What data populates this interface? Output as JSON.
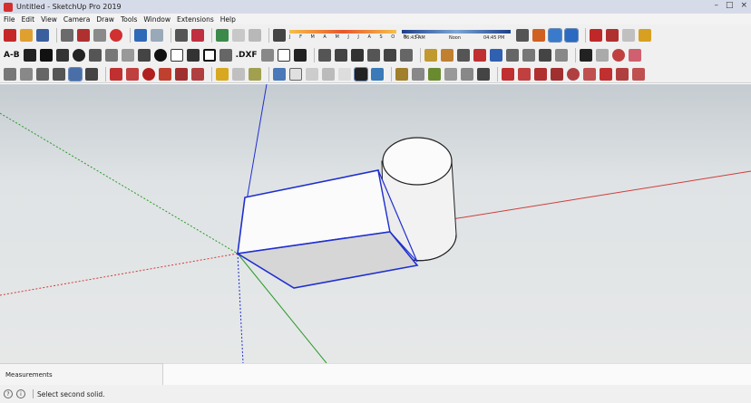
{
  "window": {
    "title": "Untitled - SketchUp Pro 2019"
  },
  "menu": [
    "File",
    "Edit",
    "View",
    "Camera",
    "Draw",
    "Tools",
    "Window",
    "Extensions",
    "Help"
  ],
  "shadow": {
    "months": "J F M A M J J A S O N D",
    "time_start": "06:43 AM",
    "time_mid": "Noon",
    "time_end": "04:45 PM"
  },
  "toolbar_labels": {
    "dimension": "A-B",
    "dxf": ".DXF"
  },
  "measurements": {
    "label": "Measurements"
  },
  "status": {
    "message": "Select second solid."
  },
  "axis_colors": {
    "red": "#d23c3c",
    "green": "#2a9a2a",
    "blue": "#1f2fd0"
  }
}
